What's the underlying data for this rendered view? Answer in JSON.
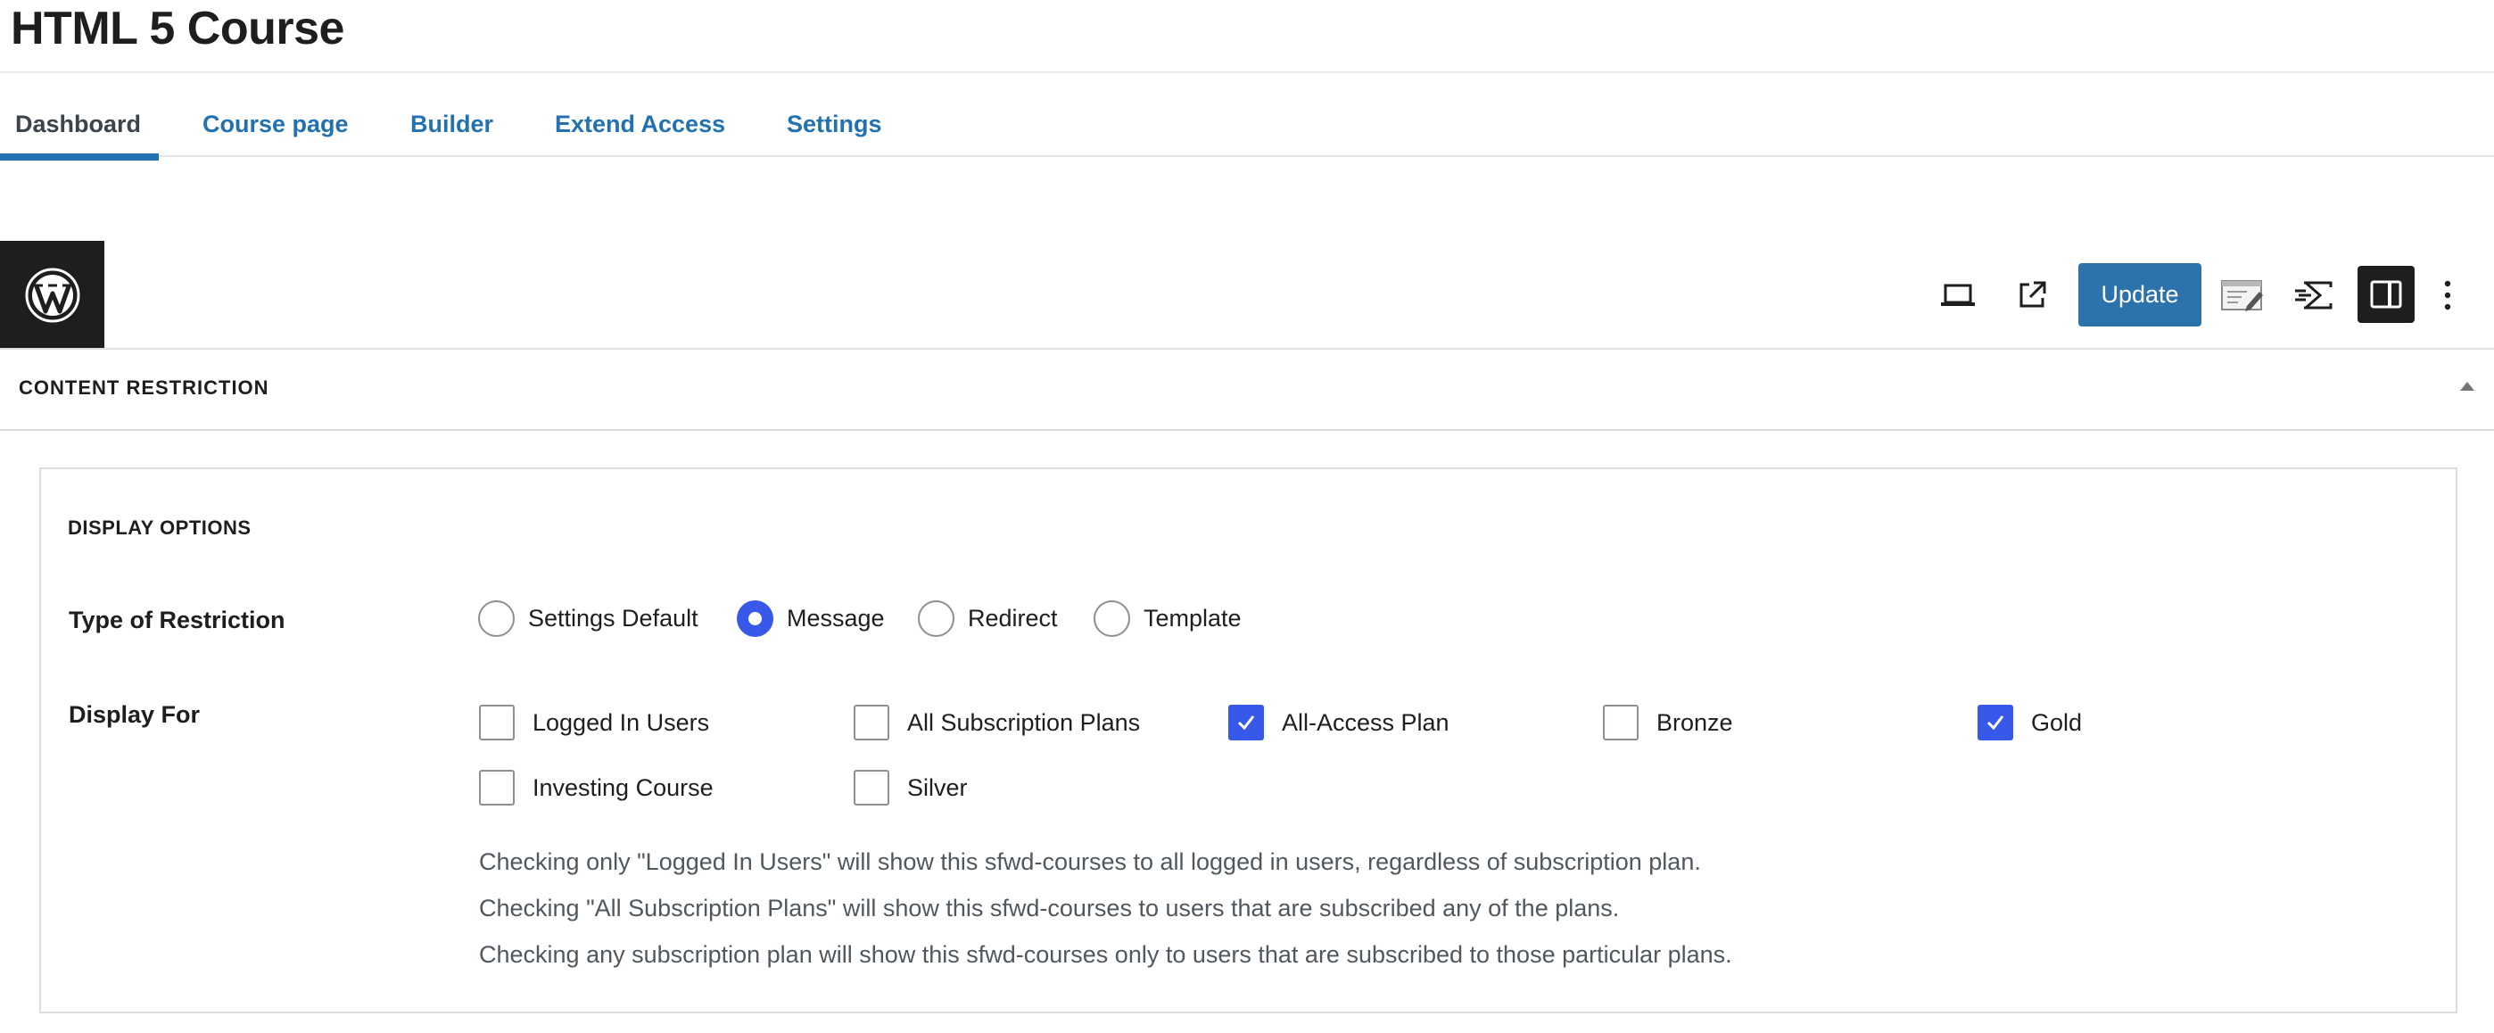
{
  "page": {
    "title": "HTML 5 Course"
  },
  "tabs": [
    {
      "label": "Dashboard",
      "active": true
    },
    {
      "label": "Course page"
    },
    {
      "label": "Builder"
    },
    {
      "label": "Extend Access"
    },
    {
      "label": "Settings"
    }
  ],
  "toolbar": {
    "update_label": "Update",
    "icons": [
      "wordpress-icon",
      "preview-desktop-icon",
      "external-link-icon",
      "learndash-edit-icon",
      "learndash-focus-icon",
      "sidebar-toggle-icon",
      "more-options-icon"
    ],
    "accent_color": "#2c72ad"
  },
  "panel": {
    "title": "CONTENT RESTRICTION",
    "display_options_label": "DISPLAY OPTIONS",
    "restriction": {
      "label": "Type of Restriction",
      "options": [
        "Settings Default",
        "Message",
        "Redirect",
        "Template"
      ],
      "selected": "Message"
    },
    "display_for": {
      "label": "Display For",
      "options": [
        {
          "label": "Logged In Users",
          "checked": false
        },
        {
          "label": "All Subscription Plans",
          "checked": false
        },
        {
          "label": "All-Access Plan",
          "checked": true
        },
        {
          "label": "Bronze",
          "checked": false
        },
        {
          "label": "Gold",
          "checked": true
        },
        {
          "label": "Investing Course",
          "checked": false
        },
        {
          "label": "Silver",
          "checked": false
        }
      ],
      "check_color": "#3858e9"
    },
    "notes": [
      "Checking only \"Logged In Users\" will show this sfwd-courses to all logged in users, regardless of subscription plan.",
      "Checking \"All Subscription Plans\" will show this sfwd-courses to users that are subscribed any of the plans.",
      "Checking any subscription plan will show this sfwd-courses only to users that are subscribed to those particular plans."
    ]
  }
}
